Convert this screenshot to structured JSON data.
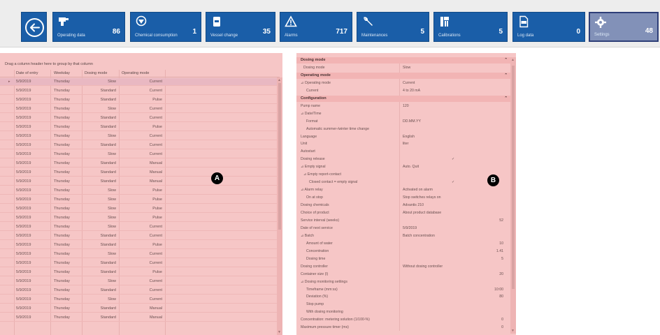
{
  "toolbar": {
    "tiles": [
      {
        "label": "Operating data",
        "count": "86",
        "icon": "pump-icon"
      },
      {
        "label": "Chemical consumption",
        "count": "1",
        "icon": "dosing-icon"
      },
      {
        "label": "Vessel change",
        "count": "35",
        "icon": "vessel-icon"
      },
      {
        "label": "Alarms",
        "count": "717",
        "icon": "warning-icon"
      },
      {
        "label": "Maintenances",
        "count": "5",
        "icon": "wrench-icon"
      },
      {
        "label": "Calibrations",
        "count": "5",
        "icon": "calibration-icon"
      },
      {
        "label": "Log data",
        "count": "0",
        "icon": "log-file-icon"
      },
      {
        "label": "Settings",
        "count": "48",
        "icon": "gear-icon"
      }
    ]
  },
  "grid": {
    "group_hint": "Drag a column header here to group by that column",
    "columns": [
      "Date of entry",
      "Weekday",
      "Dosing mode",
      "Operating mode"
    ],
    "rows": [
      [
        "5/9/2019",
        "Thursday",
        "Slow",
        "Current"
      ],
      [
        "5/9/2019",
        "Thursday",
        "Standard",
        "Current"
      ],
      [
        "5/9/2019",
        "Thursday",
        "Standard",
        "Pulse"
      ],
      [
        "5/9/2019",
        "Thursday",
        "Slow",
        "Current"
      ],
      [
        "5/9/2019",
        "Thursday",
        "Standard",
        "Current"
      ],
      [
        "5/9/2019",
        "Thursday",
        "Standard",
        "Pulse"
      ],
      [
        "5/9/2019",
        "Thursday",
        "Slow",
        "Current"
      ],
      [
        "5/9/2019",
        "Thursday",
        "Standard",
        "Current"
      ],
      [
        "5/9/2019",
        "Thursday",
        "Slow",
        "Current"
      ],
      [
        "5/9/2019",
        "Thursday",
        "Standard",
        "Manual"
      ],
      [
        "5/9/2019",
        "Thursday",
        "Standard",
        "Manual"
      ],
      [
        "5/9/2019",
        "Thursday",
        "Standard",
        "Manual"
      ],
      [
        "5/9/2019",
        "Thursday",
        "Slow",
        "Pulse"
      ],
      [
        "5/9/2019",
        "Thursday",
        "Slow",
        "Pulse"
      ],
      [
        "5/9/2019",
        "Thursday",
        "Slow",
        "Pulse"
      ],
      [
        "5/9/2019",
        "Thursday",
        "Slow",
        "Pulse"
      ],
      [
        "5/9/2019",
        "Thursday",
        "Slow",
        "Current"
      ],
      [
        "5/9/2019",
        "Thursday",
        "Standard",
        "Current"
      ],
      [
        "5/9/2019",
        "Thursday",
        "Standard",
        "Pulse"
      ],
      [
        "5/9/2019",
        "Thursday",
        "Slow",
        "Current"
      ],
      [
        "5/9/2019",
        "Thursday",
        "Standard",
        "Current"
      ],
      [
        "5/9/2019",
        "Thursday",
        "Standard",
        "Pulse"
      ],
      [
        "5/9/2019",
        "Thursday",
        "Slow",
        "Current"
      ],
      [
        "5/9/2019",
        "Thursday",
        "Standard",
        "Current"
      ],
      [
        "5/9/2019",
        "Thursday",
        "Slow",
        "Current"
      ],
      [
        "5/9/2019",
        "Thursday",
        "Standard",
        "Manual"
      ],
      [
        "5/9/2019",
        "Thursday",
        "Standard",
        "Manual"
      ]
    ],
    "badge": "A"
  },
  "properties": {
    "badge": "B",
    "items": [
      {
        "label": "Dosing mode",
        "value": "",
        "type": "category"
      },
      {
        "label": "Dosing mode",
        "value": "Slow",
        "indent": 1
      },
      {
        "label": "Operating mode",
        "value": "",
        "type": "category"
      },
      {
        "label": "⊿ Operating mode",
        "value": "Current",
        "indent": 0
      },
      {
        "label": "Current",
        "value": "4 to 20 mA",
        "indent": 2
      },
      {
        "label": "Configuration",
        "value": "",
        "type": "category"
      },
      {
        "label": "Pump name",
        "value": "120",
        "indent": 0
      },
      {
        "label": "⊿ Date/Time",
        "value": "",
        "indent": 0
      },
      {
        "label": "Format",
        "value": "DD.MM.YY",
        "indent": 2
      },
      {
        "label": "Automatic summer-/winter time change",
        "value": "",
        "indent": 2
      },
      {
        "label": "Language",
        "value": "English",
        "indent": 0
      },
      {
        "label": "Unit",
        "value": "liter",
        "indent": 0
      },
      {
        "label": "Autostart",
        "value": "",
        "indent": 0
      },
      {
        "label": "Dosing release",
        "value": "",
        "indent": 0,
        "check": true
      },
      {
        "label": "⊿ Empty signal",
        "value": "Auto. Quit",
        "indent": 0
      },
      {
        "label": "⊿ Empty report-contact",
        "value": "",
        "indent": 1
      },
      {
        "label": "Closed contact = empty signal",
        "value": "",
        "indent": 3,
        "check": true
      },
      {
        "label": "⊿ Alarm relay",
        "value": "Activated on alarm",
        "indent": 0
      },
      {
        "label": "On at stop",
        "value": "Stop switches relays on",
        "indent": 2
      },
      {
        "label": "Dosing chemicals",
        "value": "Advantis 210",
        "indent": 0
      },
      {
        "label": "Choice of product",
        "value": "About product database",
        "indent": 0
      },
      {
        "label": "Service interval (weeks)",
        "value": "52",
        "indent": 0,
        "num": true
      },
      {
        "label": "Date of next service",
        "value": "5/9/2019",
        "indent": 0
      },
      {
        "label": "⊿ Batch",
        "value": "Batch concentration",
        "indent": 0
      },
      {
        "label": "Amount of water",
        "value": "10",
        "indent": 2,
        "num": true
      },
      {
        "label": "Concentration",
        "value": "1.41",
        "indent": 2,
        "num": true
      },
      {
        "label": "Dosing time",
        "value": "5",
        "indent": 2,
        "num": true
      },
      {
        "label": "Dosing controller",
        "value": "Without dosing controller",
        "indent": 0
      },
      {
        "label": "Container size (l)",
        "value": "20",
        "indent": 0,
        "num": true
      },
      {
        "label": "⊿ Dosing monitoring settings",
        "value": "",
        "indent": 0
      },
      {
        "label": "Timeframe (mm:ss)",
        "value": "10:00",
        "indent": 2,
        "num": true
      },
      {
        "label": "Deviation (%)",
        "value": "80",
        "indent": 2,
        "num": true
      },
      {
        "label": "Stop pump",
        "value": "",
        "indent": 2
      },
      {
        "label": "With dosing monitoring",
        "value": "",
        "indent": 2
      },
      {
        "label": "Concentration: metering solution (1/100-%)",
        "value": "0",
        "indent": 0,
        "num": true
      },
      {
        "label": "Maximum pressure timer (ms)",
        "value": "0",
        "indent": 0,
        "num": true
      }
    ]
  }
}
